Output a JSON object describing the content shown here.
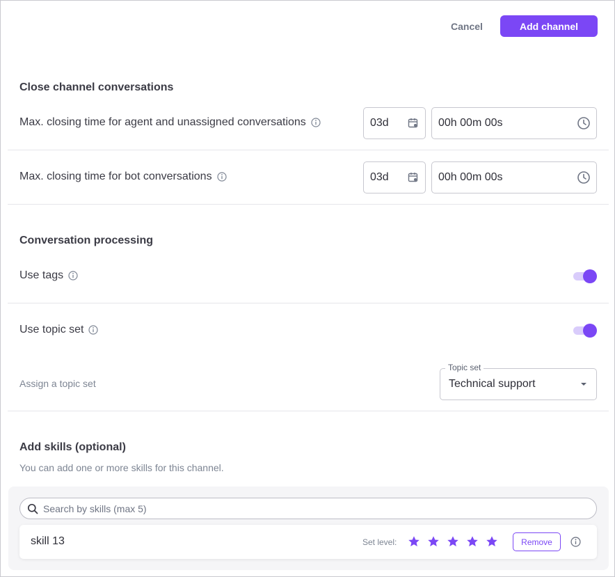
{
  "header": {
    "cancel_label": "Cancel",
    "add_channel_label": "Add channel",
    "accent_color": "#7b47f5"
  },
  "close_section": {
    "title": "Close channel conversations",
    "rows": [
      {
        "label": "Max. closing time for agent and unassigned conversations",
        "days": "03d",
        "time": "00h 00m 00s"
      },
      {
        "label": "Max. closing time for bot conversations",
        "days": "03d",
        "time": "00h 00m 00s"
      }
    ]
  },
  "processing_section": {
    "title": "Conversation processing",
    "use_tags": {
      "label": "Use tags",
      "enabled": true
    },
    "use_topic_set": {
      "label": "Use topic set",
      "enabled": true
    },
    "assign_label": "Assign a topic set",
    "topic_select": {
      "legend": "Topic set",
      "value": "Technical support"
    }
  },
  "skills_section": {
    "title": "Add skills (optional)",
    "subtitle": "You can add one or more skills for this channel.",
    "search_placeholder": "Search by skills (max 5)",
    "items": [
      {
        "name": "skill 13",
        "set_level_label": "Set level:",
        "level": 5,
        "max_level": 5,
        "remove_label": "Remove"
      }
    ]
  },
  "icons": [
    "info-icon",
    "calendar-icon",
    "clock-icon",
    "search-icon",
    "star-icon",
    "chevron-down-icon"
  ]
}
